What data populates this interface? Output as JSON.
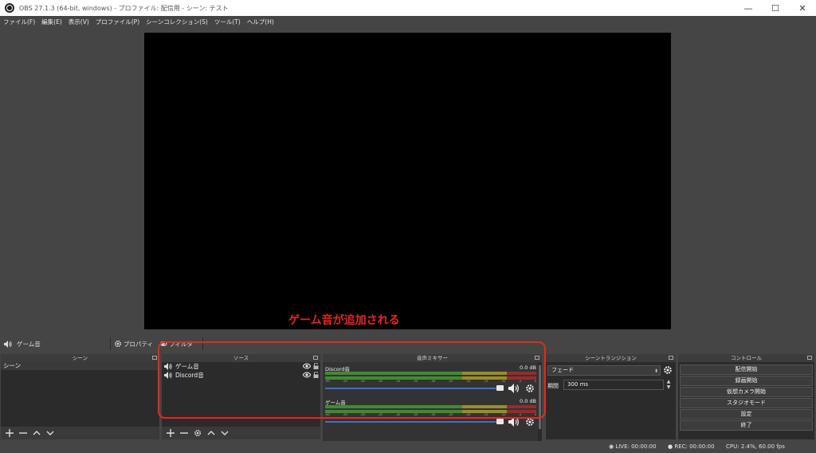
{
  "window": {
    "title": "OBS 27.1.3 (64-bit, windows) - プロファイル: 配信用 - シーン: テスト",
    "minimize": "—",
    "maximize": "☐",
    "close": "✕"
  },
  "menu": [
    "ファイル(F)",
    "編集(E)",
    "表示(V)",
    "プロファイル(P)",
    "シーンコレクション(S)",
    "ツール(T)",
    "ヘルプ(H)"
  ],
  "annotation": "ゲーム音が追加される",
  "context_bar": {
    "source_name": "ゲーム音",
    "properties_label": "プロパティ",
    "filters_label": "フィルタ"
  },
  "scenes": {
    "title": "シーン",
    "items": [
      "シーン"
    ]
  },
  "sources": {
    "title": "ソース",
    "items": [
      {
        "label": "ゲーム音",
        "icon": "speaker-icon"
      },
      {
        "label": "Discord音",
        "icon": "speaker-icon"
      }
    ]
  },
  "mixer": {
    "title": "音声ミキサー",
    "ticks": [
      "-60",
      "-55",
      "-50",
      "-45",
      "-40",
      "-35",
      "-30",
      "-25",
      "-20",
      "-15",
      "-10",
      "-5",
      "0"
    ],
    "channels": [
      {
        "name": "Discord音",
        "db": "0.0 dB",
        "level": 1.0
      },
      {
        "name": "ゲーム音",
        "db": "0.0 dB",
        "level": 1.0
      }
    ]
  },
  "transitions": {
    "title": "シーントランジション",
    "selected": "フェード",
    "duration_label": "期間",
    "duration_value": "300 ms"
  },
  "controls": {
    "title": "コントロール",
    "buttons": [
      "配信開始",
      "録画開始",
      "仮想カメラ開始",
      "スタジオモード",
      "設定",
      "終了"
    ]
  },
  "status": {
    "live": "LIVE: 00:00:00",
    "rec": "REC: 00:00:00",
    "cpu": "CPU: 2.4%, 60.00 fps"
  },
  "colors": {
    "annotation": "#e8281c",
    "fader": "#3a72c6",
    "meter_green": "#3f8c2e",
    "meter_yellow": "#9a8d25",
    "meter_red": "#9a2a2a"
  }
}
